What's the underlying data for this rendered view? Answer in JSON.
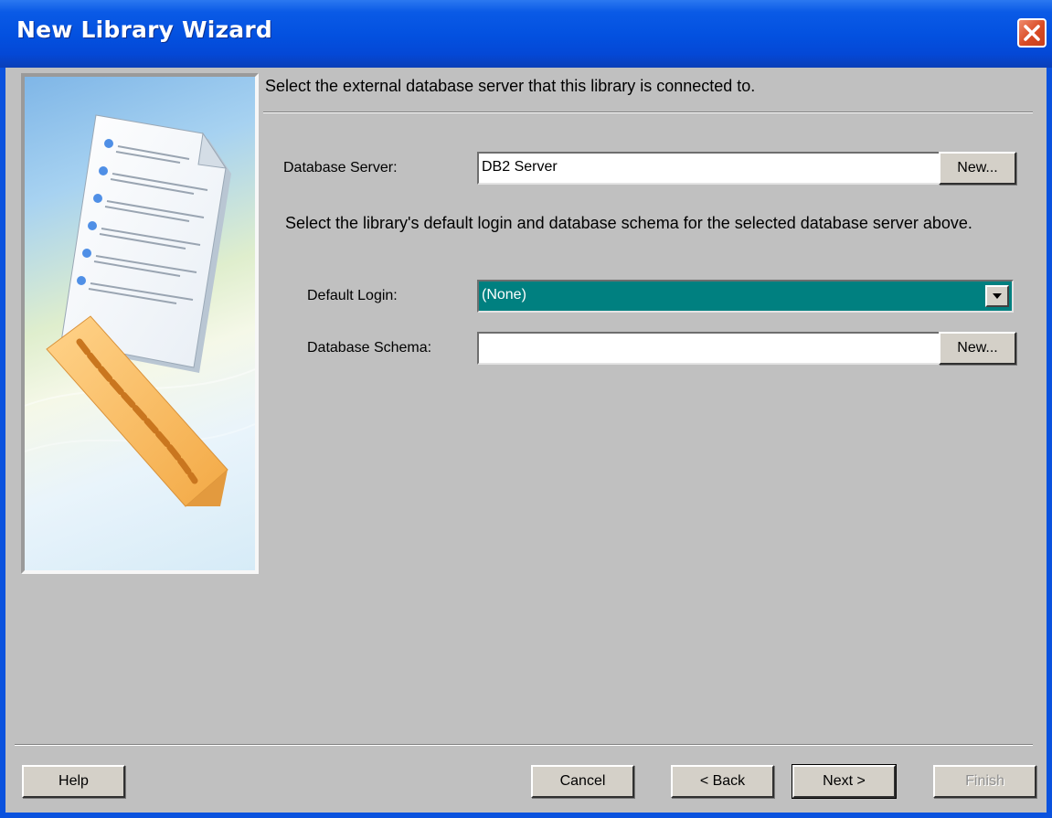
{
  "window": {
    "title": "New Library Wizard"
  },
  "content": {
    "intro": "Select the external database server that this library is connected to.",
    "database_server_label": "Database Server:",
    "database_server_value": "DB2 Server",
    "new_server_label": "New...",
    "login_schema_paragraph": "Select the library's default login and database schema for the selected database server above.",
    "default_login_label": "Default Login:",
    "default_login_value": "(None)",
    "database_schema_label": "Database Schema:",
    "database_schema_value": "",
    "new_schema_label": "New..."
  },
  "footer": {
    "help_label": "Help",
    "cancel_label": "Cancel",
    "back_label": "< Back",
    "next_label": "Next >",
    "finish_label": "Finish"
  },
  "colors": {
    "titlebar": "#0351e0",
    "client": "#c0c0c0",
    "selection": "#008080"
  },
  "icons": {
    "close": "close-icon",
    "dropdown": "chevron-down-icon",
    "side_image": "wizard-document-illustration"
  }
}
